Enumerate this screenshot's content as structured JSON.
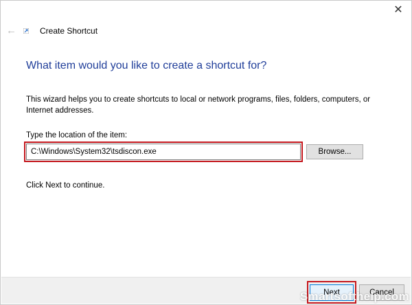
{
  "window": {
    "title": "Create Shortcut",
    "close_glyph": "✕",
    "back_glyph": "←",
    "accent_color": "#1f3d99",
    "highlight_color": "#c4161c"
  },
  "wizard": {
    "heading": "What item would you like to create a shortcut for?",
    "description": "This wizard helps you to create shortcuts to local or network programs, files, folders, computers, or Internet addresses.",
    "location_label": "Type the location of the item:",
    "location_value": "C:\\Windows\\System32\\tsdiscon.exe",
    "browse_label": "Browse...",
    "hint": "Click Next to continue."
  },
  "footer": {
    "next_label": "Next",
    "cancel_label": "Cancel"
  },
  "watermark": {
    "text": "Smartsofthelp.com"
  }
}
